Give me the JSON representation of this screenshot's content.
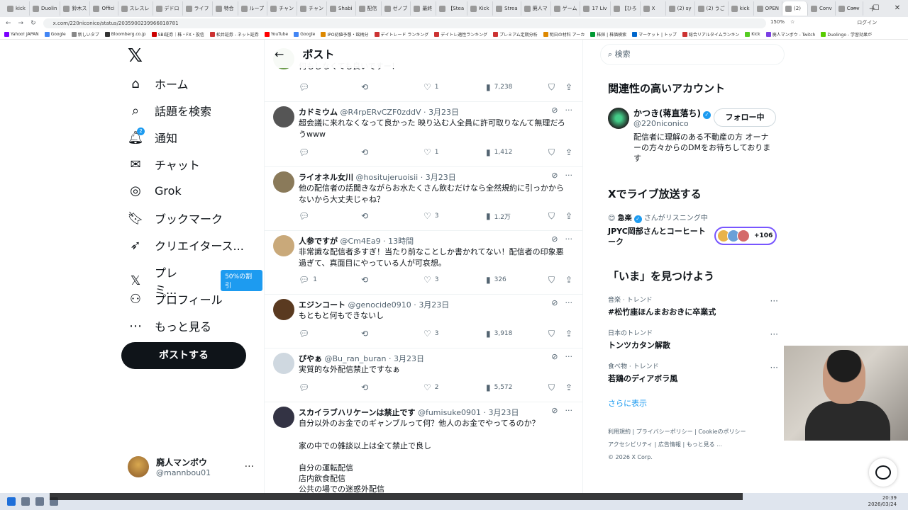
{
  "browser": {
    "tabs": [
      "kick",
      "Duolin",
      "鈴木ス",
      "Offici",
      "スレスレ",
      "デドロ",
      "ライフ",
      "特合",
      "ループ",
      "チャン",
      "チャン",
      "Shabi",
      "配信",
      "ゼノブ",
      "最終",
      "【Stea",
      "Kick",
      "Strea",
      "廃人マ",
      "ゲーム",
      "17 Liv",
      "【ひろ",
      "X",
      "(2) sy",
      "(2) うご",
      "kick",
      "OPEN",
      "(2)",
      "Conv",
      "Conv"
    ],
    "active_tab_index": 27,
    "new_tab": "+",
    "window_controls": [
      "—",
      "☐",
      "✕"
    ],
    "url": "x.com/220niconico/status/2035900239966818781",
    "zoom": "150%",
    "profile": "ログイン",
    "bookmarks": [
      "Yahoo! JAPAN",
      "Google",
      "新しいタブ",
      "Bloomberg.co.jp",
      "SBI証券｜株・FX・投信",
      "松井証券 - ネット証券",
      "YouTube",
      "Google",
      "IPO初値予想・銘柄分",
      "デイトレード ランキング",
      "デイトレ適性ランキング",
      "プレミアム定期分析",
      "明日の材料 アーカ",
      "株探 | 株価検索",
      "マーケット | トップ",
      "総合リアルタイムランキン",
      "Kick",
      "廃人マンボウ - Twitch",
      "Duolingo - 学習効果が"
    ]
  },
  "nav": {
    "items": [
      {
        "label": "ホーム",
        "icon": "home-icon"
      },
      {
        "label": "話題を検索",
        "icon": "search-icon"
      },
      {
        "label": "通知",
        "icon": "bell-icon",
        "badge": "2"
      },
      {
        "label": "チャット",
        "icon": "mail-icon"
      },
      {
        "label": "Grok",
        "icon": "grok-icon"
      },
      {
        "label": "ブックマーク",
        "icon": "bookmark-icon"
      },
      {
        "label": "クリエイタース...",
        "icon": "rocket-icon"
      },
      {
        "label": "プレミ...",
        "icon": "x-premium-icon",
        "badge": "50%の割引"
      },
      {
        "label": "プロフィール",
        "icon": "person-icon"
      },
      {
        "label": "もっと見る",
        "icon": "more-circle-icon"
      }
    ],
    "post_button": "ポストする",
    "account": {
      "name": "廃人マンボウ",
      "handle": "@mannbou01",
      "more": "···"
    }
  },
  "header": {
    "back": "←",
    "title": "ポスト"
  },
  "tweets": [
    {
      "name": "",
      "handle": "",
      "time": "",
      "text": "何もしなくても良いですー！",
      "reply": "",
      "like": "1",
      "views": "7,238"
    },
    {
      "name": "カドミウム",
      "handle": "@R4rpERvCZF0zddV",
      "time": "3月23日",
      "text": "超会議に来れなくなって良かった 映り込む人全員に許可取りなんて無理だろうwww",
      "reply": "",
      "like": "1",
      "views": "1,412"
    },
    {
      "name": "ライオネル女川",
      "handle": "@hositujeruoisii",
      "time": "3月23日",
      "text": "他の配信者の話聞きながらお水たくさん飲むだけなら全然規約に引っかからないから大丈夫じゃね？",
      "reply": "",
      "like": "3",
      "views": "1.2万"
    },
    {
      "name": "人参ですが",
      "handle": "@Cm4Ea9",
      "time": "13時間",
      "text": "非常識な配信者多すぎ！当たり前なことしか書かれてない！配信者の印象悪過ぎて、真面目にやっている人が可哀想。",
      "reply": "1",
      "like": "3",
      "views": "326"
    },
    {
      "name": "エジンコート",
      "handle": "@genocide0910",
      "time": "3月23日",
      "text": "もともと何もできないし",
      "reply": "",
      "like": "3",
      "views": "3,918"
    },
    {
      "name": "ぴやぁ",
      "handle": "@Bu_ran_buran",
      "time": "3月23日",
      "text": "実質的な外配信禁止ですなぁ",
      "reply": "",
      "like": "2",
      "views": "5,572"
    },
    {
      "name": "スカイラブハリケーンは禁止です",
      "handle": "@fumisuke0901",
      "time": "3月23日",
      "text": "自分以外のお金でのギャンブルって何？他人のお金でやってるのか？",
      "reply": "",
      "like": "",
      "views": ""
    }
  ],
  "tweet_extra_lines": [
    "家の中での雑談以上は全て禁止で良し",
    "自分の運転配信",
    "店内飲食配信",
    "公共の場での迷惑外配信"
  ],
  "right": {
    "search_placeholder": "検索",
    "related_title": "関連性の高いアカウント",
    "related": {
      "name": "かつき(蒋直落ち)",
      "handle": "@220niconico",
      "follow": "フォロー中",
      "bio": "配信者に理解のある不動産の方 オーナーの方々からのDMをお待ちしております"
    },
    "live_title": "Xでライブ放送する",
    "live": {
      "host": "急楽",
      "status": "さんがリスニング中",
      "title": "JPYC岡部さんとコーヒートーク",
      "count": "+106"
    },
    "trends_title": "「いま」を見つけよう",
    "trends": [
      {
        "category": "音楽 · トレンド",
        "title": "#松竹座ほんまおおきに卒業式"
      },
      {
        "category": "日本のトレンド",
        "title": "トンツカタン解散"
      },
      {
        "category": "食べ物 · トレンド",
        "title": "若鶏のディアボラ風"
      }
    ],
    "show_more": "さらに表示",
    "footer": [
      "利用規約",
      "プライバシーポリシー",
      "Cookieのポリシー",
      "アクセシビリティ",
      "広告情報",
      "もっと見る ...",
      "© 2026 X Corp."
    ]
  },
  "taskbar": {
    "time": "20:39",
    "date": "2026/03/24"
  }
}
